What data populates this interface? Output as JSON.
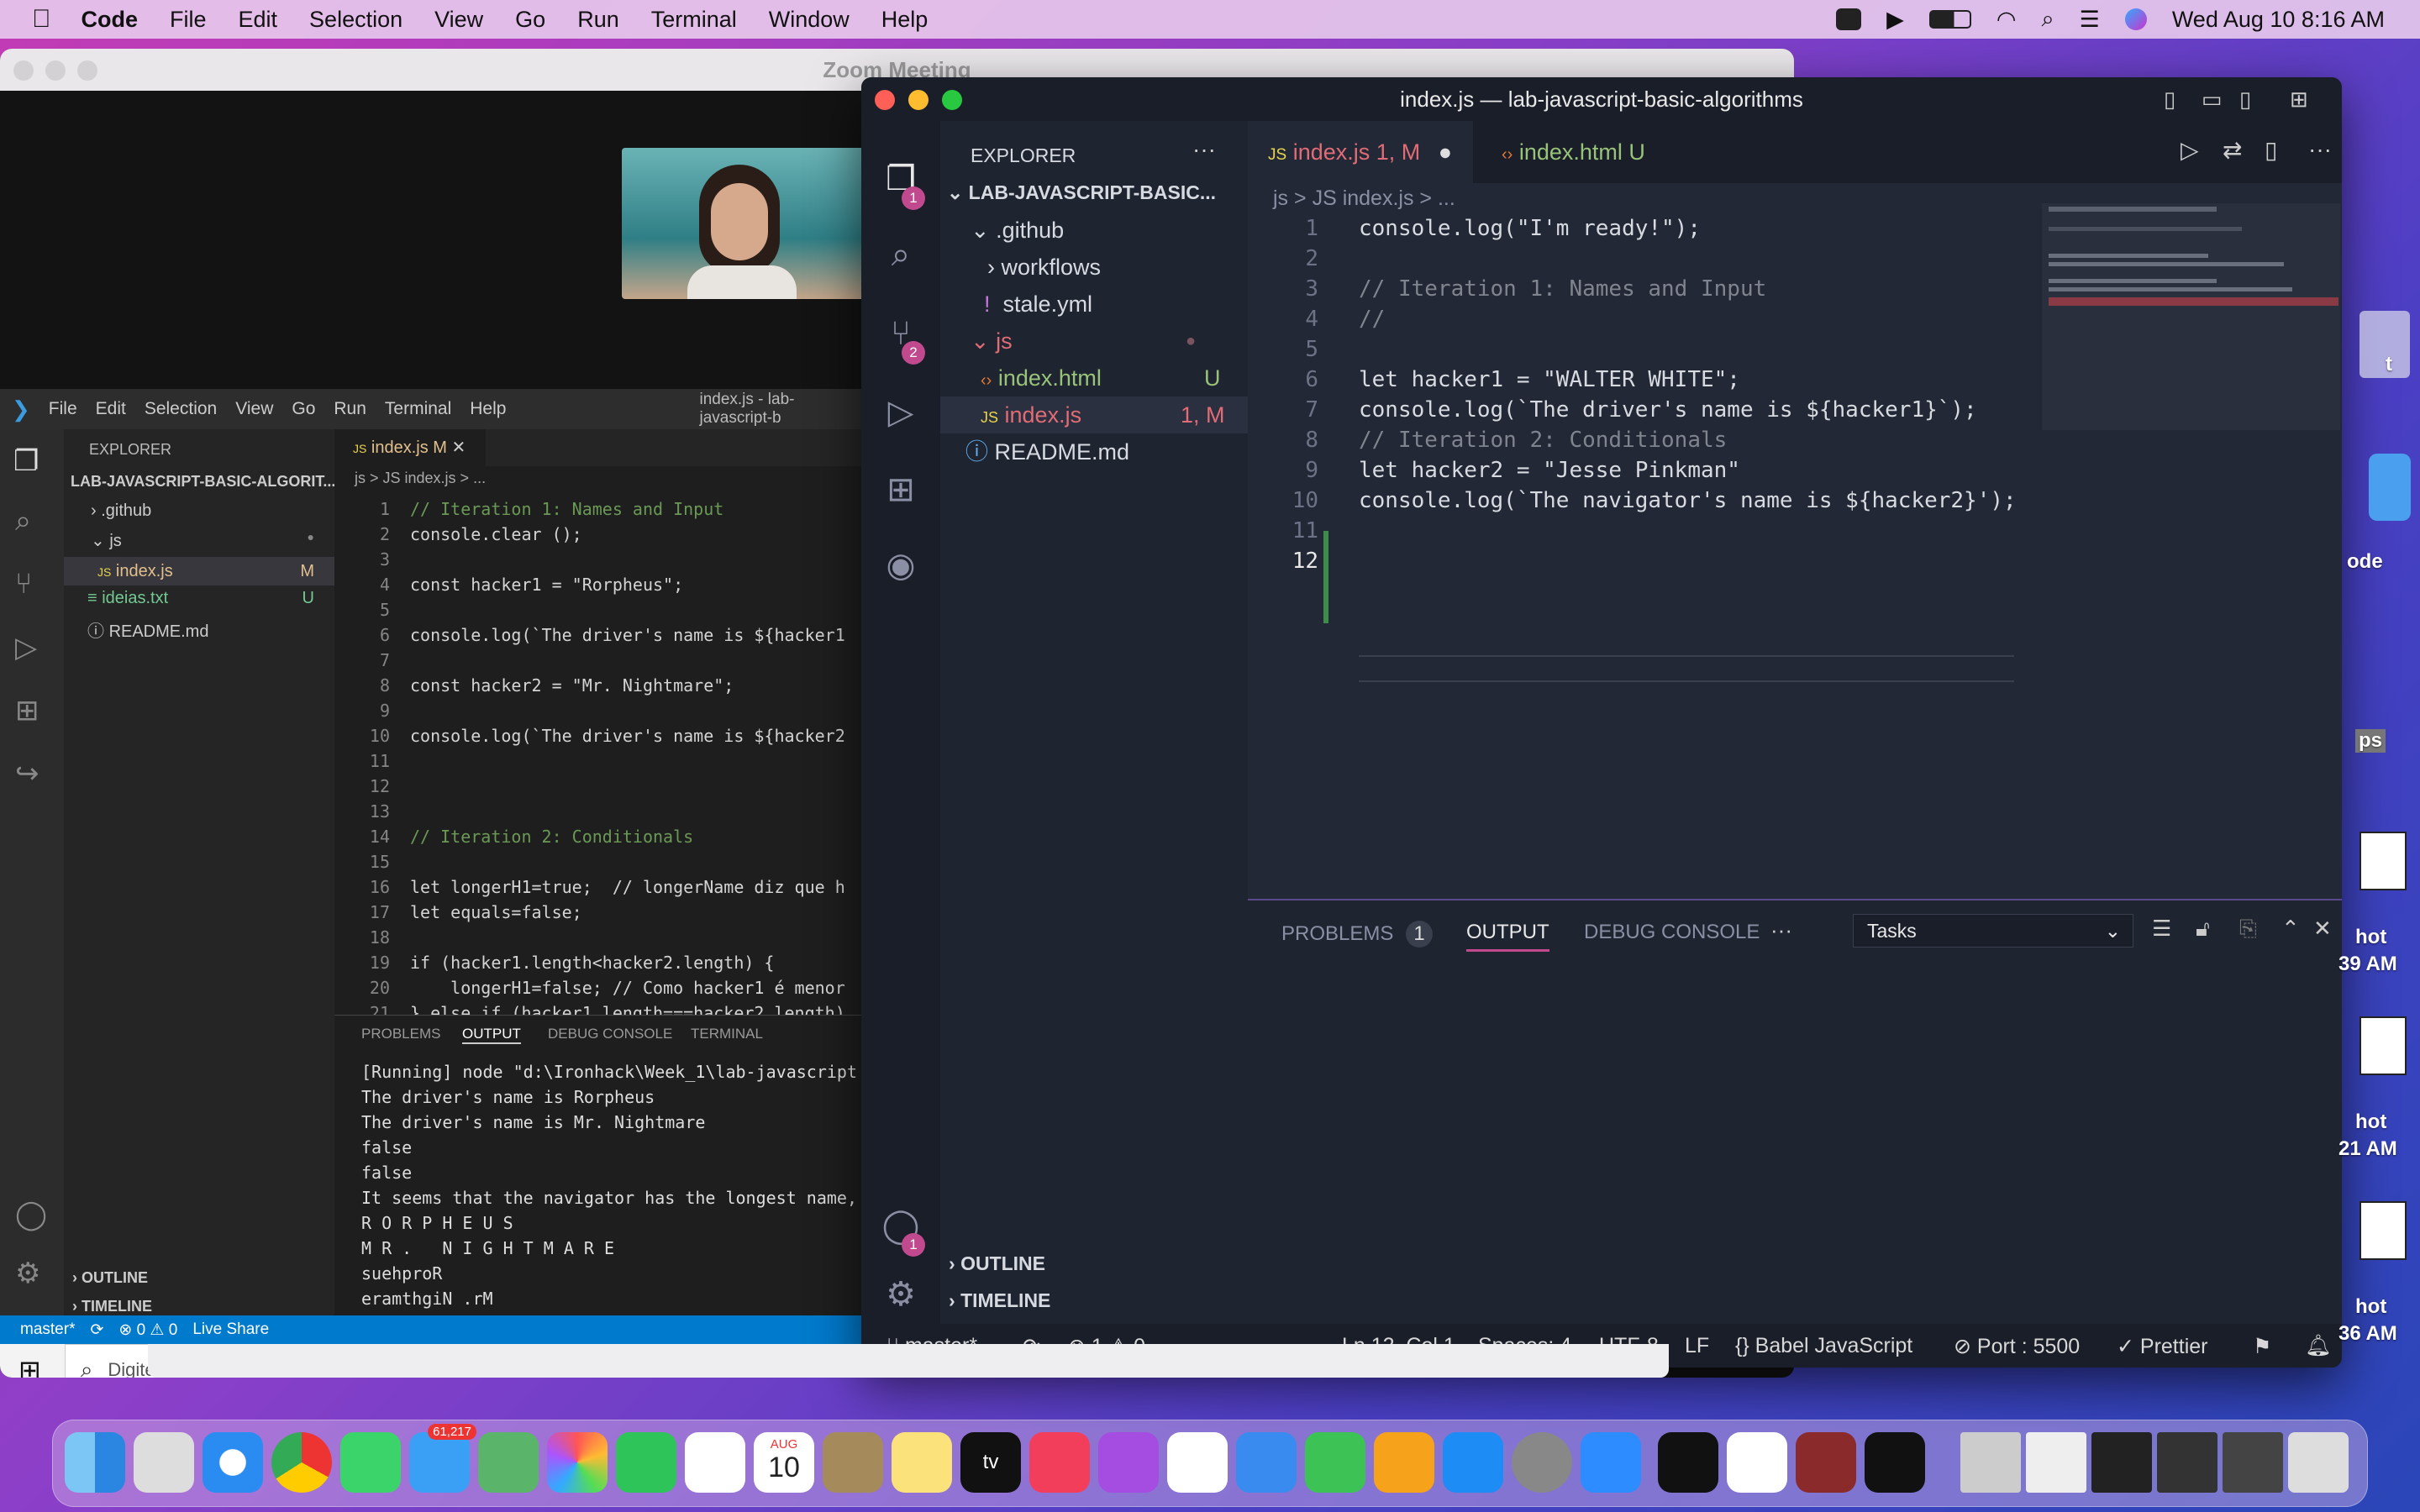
{
  "menubar": {
    "app": "Code",
    "items": [
      "File",
      "Edit",
      "Selection",
      "View",
      "Go",
      "Run",
      "Terminal",
      "Window",
      "Help"
    ],
    "datetime": "Wed Aug 10  8:16 AM"
  },
  "zoom": {
    "title": "Zoom Meeting"
  },
  "win": {
    "menu": [
      "File",
      "Edit",
      "Selection",
      "View",
      "Go",
      "Run",
      "Terminal",
      "Help"
    ],
    "title": "index.js - lab-javascript-b",
    "explorer": "EXPLORER",
    "project": "LAB-JAVASCRIPT-BASIC-ALGORIT...",
    "tree": [
      {
        "name": ".github",
        "badge": ""
      },
      {
        "name": "js",
        "badge": "●"
      },
      {
        "name": "index.js",
        "badge": "M"
      },
      {
        "name": "ideias.txt",
        "badge": "U"
      },
      {
        "name": "README.md",
        "badge": ""
      }
    ],
    "tab": "index.js",
    "tab_badge": "M",
    "breadcrumb": "js > JS index.js > ...",
    "code": [
      [
        "1",
        "// Iteration 1: Names and Input"
      ],
      [
        "2",
        "console.clear ();"
      ],
      [
        "3",
        ""
      ],
      [
        "4",
        "const hacker1 = \"Rorpheus\";"
      ],
      [
        "5",
        ""
      ],
      [
        "6",
        "console.log(`The driver's name is ${hacker1"
      ],
      [
        "7",
        ""
      ],
      [
        "8",
        "const hacker2 = \"Mr. Nightmare\";"
      ],
      [
        "9",
        ""
      ],
      [
        "10",
        "console.log(`The driver's name is ${hacker2"
      ],
      [
        "11",
        ""
      ],
      [
        "12",
        ""
      ],
      [
        "13",
        ""
      ],
      [
        "14",
        "// Iteration 2: Conditionals"
      ],
      [
        "15",
        ""
      ],
      [
        "16",
        "let longerH1=true;  // longerName diz que h"
      ],
      [
        "17",
        "let equals=false;"
      ],
      [
        "18",
        ""
      ],
      [
        "19",
        "if (hacker1.length<hacker2.length) {"
      ],
      [
        "20",
        "    longerH1=false; // Como hacker1 é menor"
      ],
      [
        "21",
        "} else if (hacker1.length===hacker2.length)"
      ]
    ],
    "panel_tabs": [
      "PROBLEMS",
      "OUTPUT",
      "DEBUG CONSOLE",
      "TERMINAL"
    ],
    "output": [
      "[Running] node \"d:\\Ironhack\\Week_1\\lab-javascript",
      "The driver's name is Rorpheus",
      "The driver's name is Mr. Nightmare",
      "false",
      "false",
      "It seems that the navigator has the longest name,",
      "R O R P H E U S",
      "M R .   N I G H T M A R E",
      "suehproR",
      "eramthgiN .rM"
    ],
    "outline": "OUTLINE",
    "timeline": "TIMELINE",
    "status": [
      "master*",
      "⊗ 0 ⚠ 0",
      "Live Share"
    ],
    "search_placeholder": "Digite aqui para pesquisar"
  },
  "vs": {
    "title": "index.js — lab-javascript-basic-algorithms",
    "explorer": "EXPLORER",
    "project": "LAB-JAVASCRIPT-BASIC...",
    "tree": [
      {
        "name": ".github",
        "badge": ""
      },
      {
        "name": "workflows",
        "badge": ""
      },
      {
        "name": "stale.yml",
        "badge": ""
      },
      {
        "name": "js",
        "badge": ""
      },
      {
        "name": "index.html",
        "badge": "U"
      },
      {
        "name": "index.js",
        "badge": "1, M"
      },
      {
        "name": "README.md",
        "badge": ""
      }
    ],
    "tabs": [
      {
        "label": "index.js",
        "badge": "1, M"
      },
      {
        "label": "index.html",
        "badge": "U"
      }
    ],
    "breadcrumb": [
      "js",
      ">",
      "JS index.js",
      ">",
      "..."
    ],
    "code": [
      {
        "n": "1",
        "t": "console.log(\"I'm ready!\");"
      },
      {
        "n": "2",
        "t": ""
      },
      {
        "n": "3",
        "t": "// Iteration 1: Names and Input"
      },
      {
        "n": "4",
        "t": "//"
      },
      {
        "n": "5",
        "t": ""
      },
      {
        "n": "6",
        "t": "let hacker1 = \"WALTER WHITE\";"
      },
      {
        "n": "7",
        "t": "console.log(`The driver's name is ${hacker1}`);"
      },
      {
        "n": "8",
        "t": "// Iteration 2: Conditionals"
      },
      {
        "n": "9",
        "t": "let hacker2 = \"Jesse Pinkman\""
      },
      {
        "n": "10",
        "t": "console.log(`The navigator's name is ${hacker2}');"
      },
      {
        "n": "11",
        "t": ""
      },
      {
        "n": "12",
        "t": ""
      }
    ],
    "panel": {
      "tabs": [
        "PROBLEMS",
        "OUTPUT",
        "DEBUG CONSOLE"
      ],
      "problems_count": "1",
      "more": "···",
      "select": "Tasks"
    },
    "outline": "OUTLINE",
    "timeline": "TIMELINE",
    "status": {
      "branch": "master*",
      "errors": "1",
      "warnings": "0",
      "position": "Ln 12, Col 1",
      "spaces": "Spaces: 4",
      "encoding": "UTF-8",
      "eol": "LF",
      "language": "Babel JavaScript",
      "port": "Port : 5500",
      "prettier": "Prettier"
    },
    "badges": {
      "explorer": "1",
      "scm": "2",
      "account": "1"
    }
  },
  "desktop": {
    "labels": [
      "t",
      "ode",
      "ps",
      "hot",
      "39 AM",
      "hot",
      "21 AM",
      "hot",
      "36 AM"
    ]
  },
  "dock": {
    "mail_badge": "61,217",
    "calendar_month": "AUG",
    "calendar_day": "10",
    "tv": "tv"
  },
  "colors": {
    "accent": "#c14a8f",
    "vscode_blue": "#007acc"
  }
}
